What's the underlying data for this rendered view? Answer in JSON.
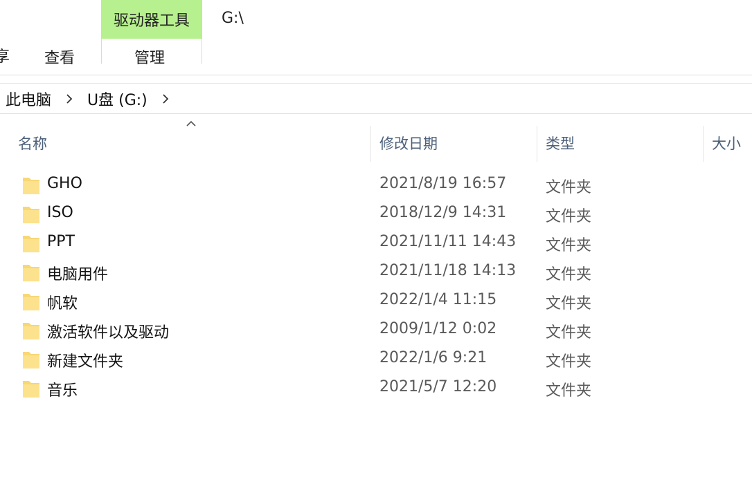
{
  "ribbon": {
    "tabs": [
      {
        "label": "享"
      },
      {
        "label": "查看"
      },
      {
        "label": "管理"
      }
    ],
    "context_group": "驱动器工具",
    "context_color": "#b7f08e",
    "window_title": "G:\\"
  },
  "address": {
    "crumbs": [
      "此电脑",
      "U盘 (G:)"
    ]
  },
  "columns": {
    "name": "名称",
    "date": "修改日期",
    "type": "类型",
    "size": "大小"
  },
  "files": [
    {
      "name": "GHO",
      "date": "2021/8/19 16:57",
      "type": "文件夹"
    },
    {
      "name": "ISO",
      "date": "2018/12/9 14:31",
      "type": "文件夹"
    },
    {
      "name": "PPT",
      "date": "2021/11/11 14:43",
      "type": "文件夹"
    },
    {
      "name": "电脑用件",
      "date": "2021/11/18 14:13",
      "type": "文件夹"
    },
    {
      "name": "帆软",
      "date": "2022/1/4 11:15",
      "type": "文件夹"
    },
    {
      "name": "激活软件以及驱动",
      "date": "2009/1/12 0:02",
      "type": "文件夹"
    },
    {
      "name": "新建文件夹",
      "date": "2022/1/6 9:21",
      "type": "文件夹"
    },
    {
      "name": "音乐",
      "date": "2021/5/7 12:20",
      "type": "文件夹"
    }
  ],
  "icons": {
    "folder": "folder-icon",
    "sort": "sort-ascending-icon",
    "separator": "chevron-right-icon"
  },
  "colors": {
    "folder": "#f8d775",
    "header_text": "#4c607a"
  }
}
